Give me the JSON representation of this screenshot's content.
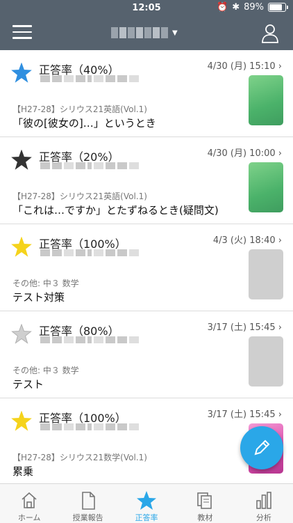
{
  "status_bar": {
    "time": "12:05",
    "battery": "89%",
    "battery_level": 0.89
  },
  "nav": {
    "menu_icon": "hamburger-icon",
    "account_icon": "person-icon"
  },
  "items": [
    {
      "score": "正答率（40%）",
      "date": "4/30 (月) 15:10",
      "star": "blue",
      "category": "【H27-28】シリウス21英語(Vol.1)",
      "name": "「彼の[彼女の]…」というとき",
      "thumb": "green"
    },
    {
      "score": "正答率（20%）",
      "date": "4/30 (月) 10:00",
      "star": "black",
      "category": "【H27-28】シリウス21英語(Vol.1)",
      "name": "「これは…ですか」とたずねるとき(疑問文)",
      "thumb": "green"
    },
    {
      "score": "正答率（100%）",
      "date": "4/3 (火) 18:40",
      "star": "yellow",
      "category": "その他: 中３ 数学",
      "name": "テスト対策",
      "thumb": "gray"
    },
    {
      "score": "正答率（80%）",
      "date": "3/17 (土) 15:45",
      "star": "silver",
      "category": "その他: 中３ 数学",
      "name": "テスト",
      "thumb": "gray"
    },
    {
      "score": "正答率（100%）",
      "date": "3/17 (土) 15:45",
      "star": "yellow",
      "category": "【H27-28】シリウス21数学(Vol.1)",
      "name": "累乗",
      "thumb": "pink"
    }
  ],
  "colors": {
    "blue": "#2f8fe0",
    "black": "#333333",
    "yellow": "#f5d31c",
    "silver": "#cfcfcf",
    "accent": "#2aa7e8",
    "header": "#56626e"
  },
  "fab_icon": "pencil-icon",
  "tabs": [
    {
      "label": "ホーム",
      "icon": "home-icon"
    },
    {
      "label": "授業報告",
      "icon": "document-icon"
    },
    {
      "label": "正答率",
      "icon": "star-icon",
      "active": true
    },
    {
      "label": "教材",
      "icon": "books-icon"
    },
    {
      "label": "分析",
      "icon": "bar-chart-icon"
    }
  ]
}
